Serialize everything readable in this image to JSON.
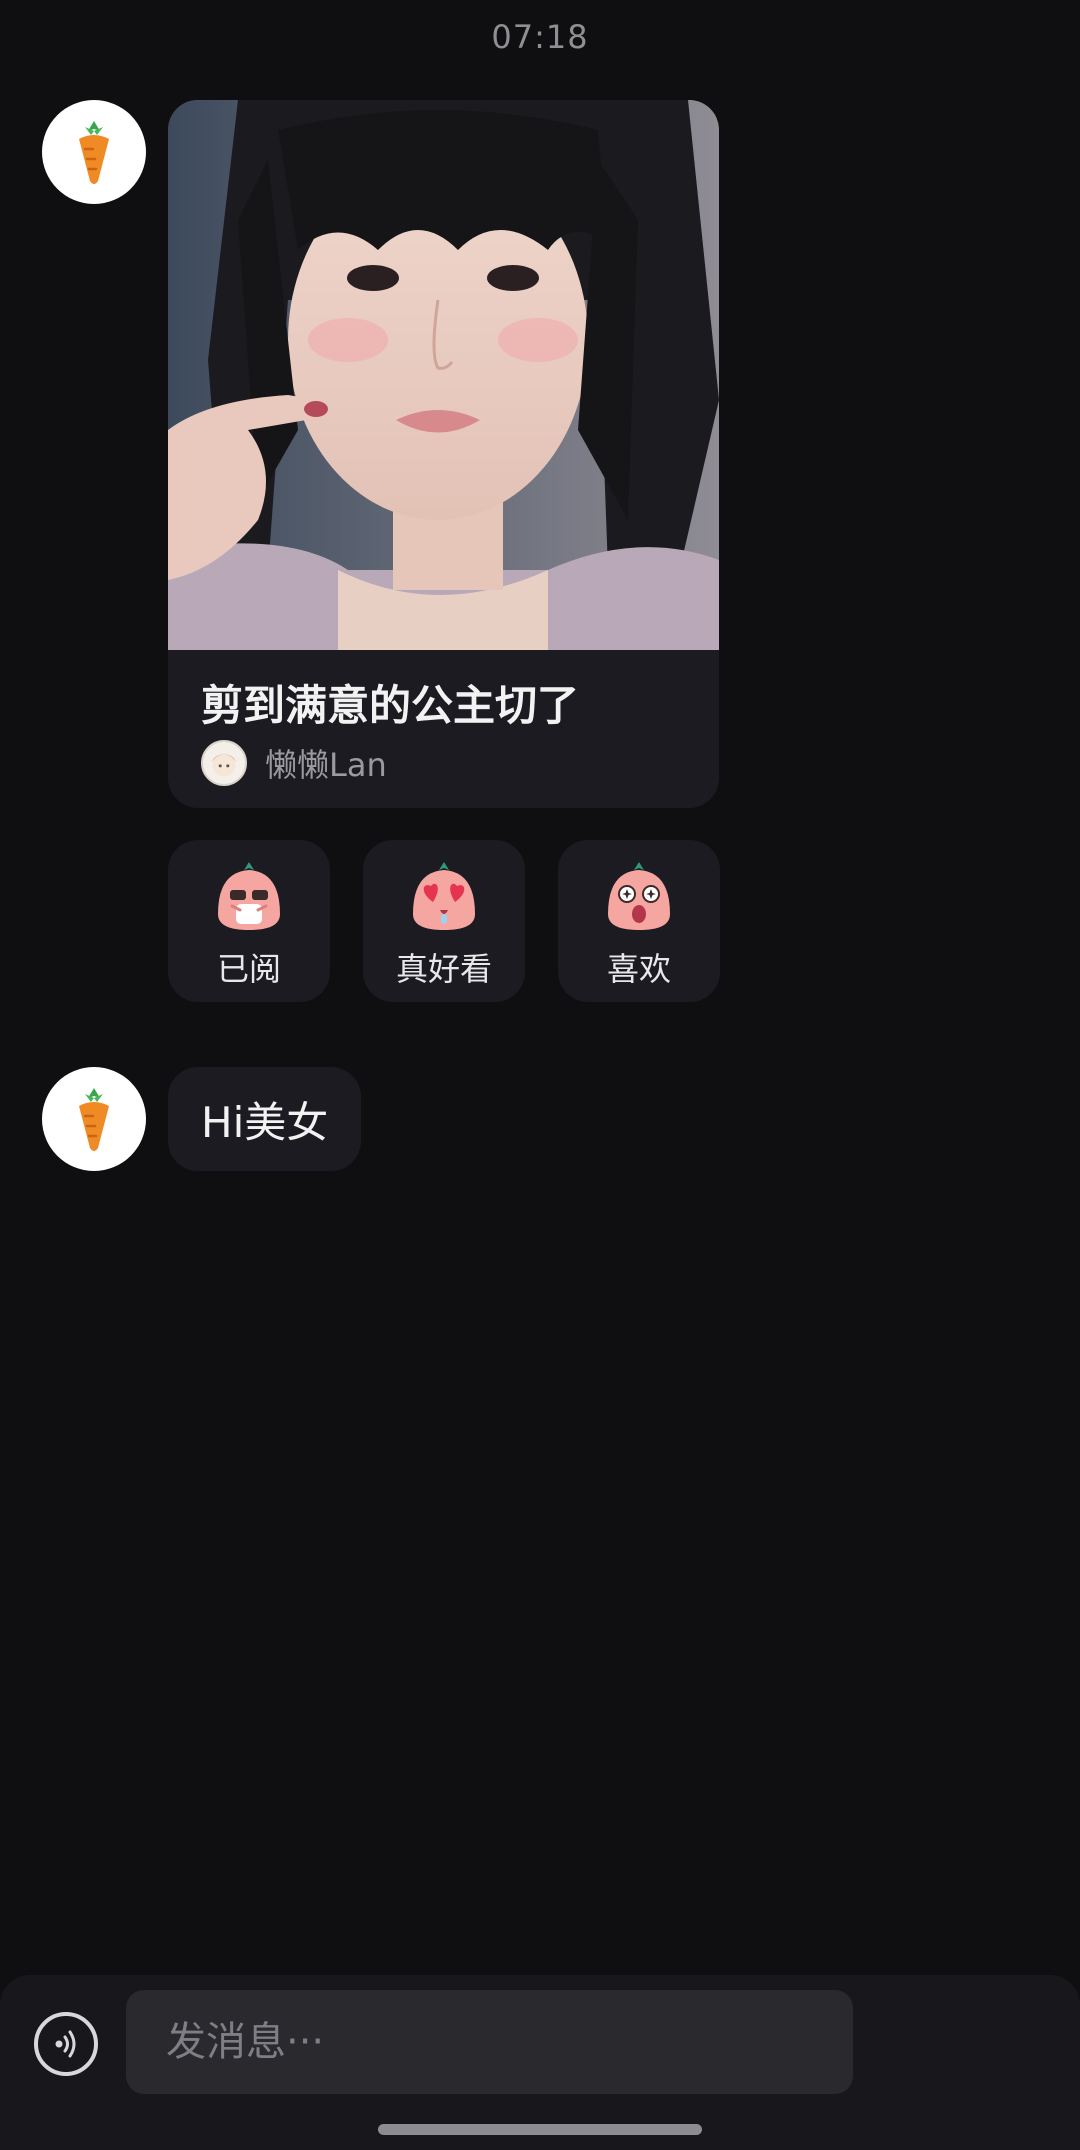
{
  "timestamp": "07:18",
  "messages": {
    "card": {
      "title": "剪到满意的公主切了",
      "author": "懒懒Lan"
    },
    "reactions": [
      {
        "label": "已阅",
        "icon": "read-emoji-icon"
      },
      {
        "label": "真好看",
        "icon": "heart-eyes-emoji-icon"
      },
      {
        "label": "喜欢",
        "icon": "star-eyes-emoji-icon"
      }
    ],
    "text_message": "Hi美女"
  },
  "input": {
    "placeholder": "发消息···"
  },
  "colors": {
    "background": "#0f0f12",
    "bubble": "#1c1b21",
    "input": "#29292e",
    "carrot": "#f08a24"
  }
}
